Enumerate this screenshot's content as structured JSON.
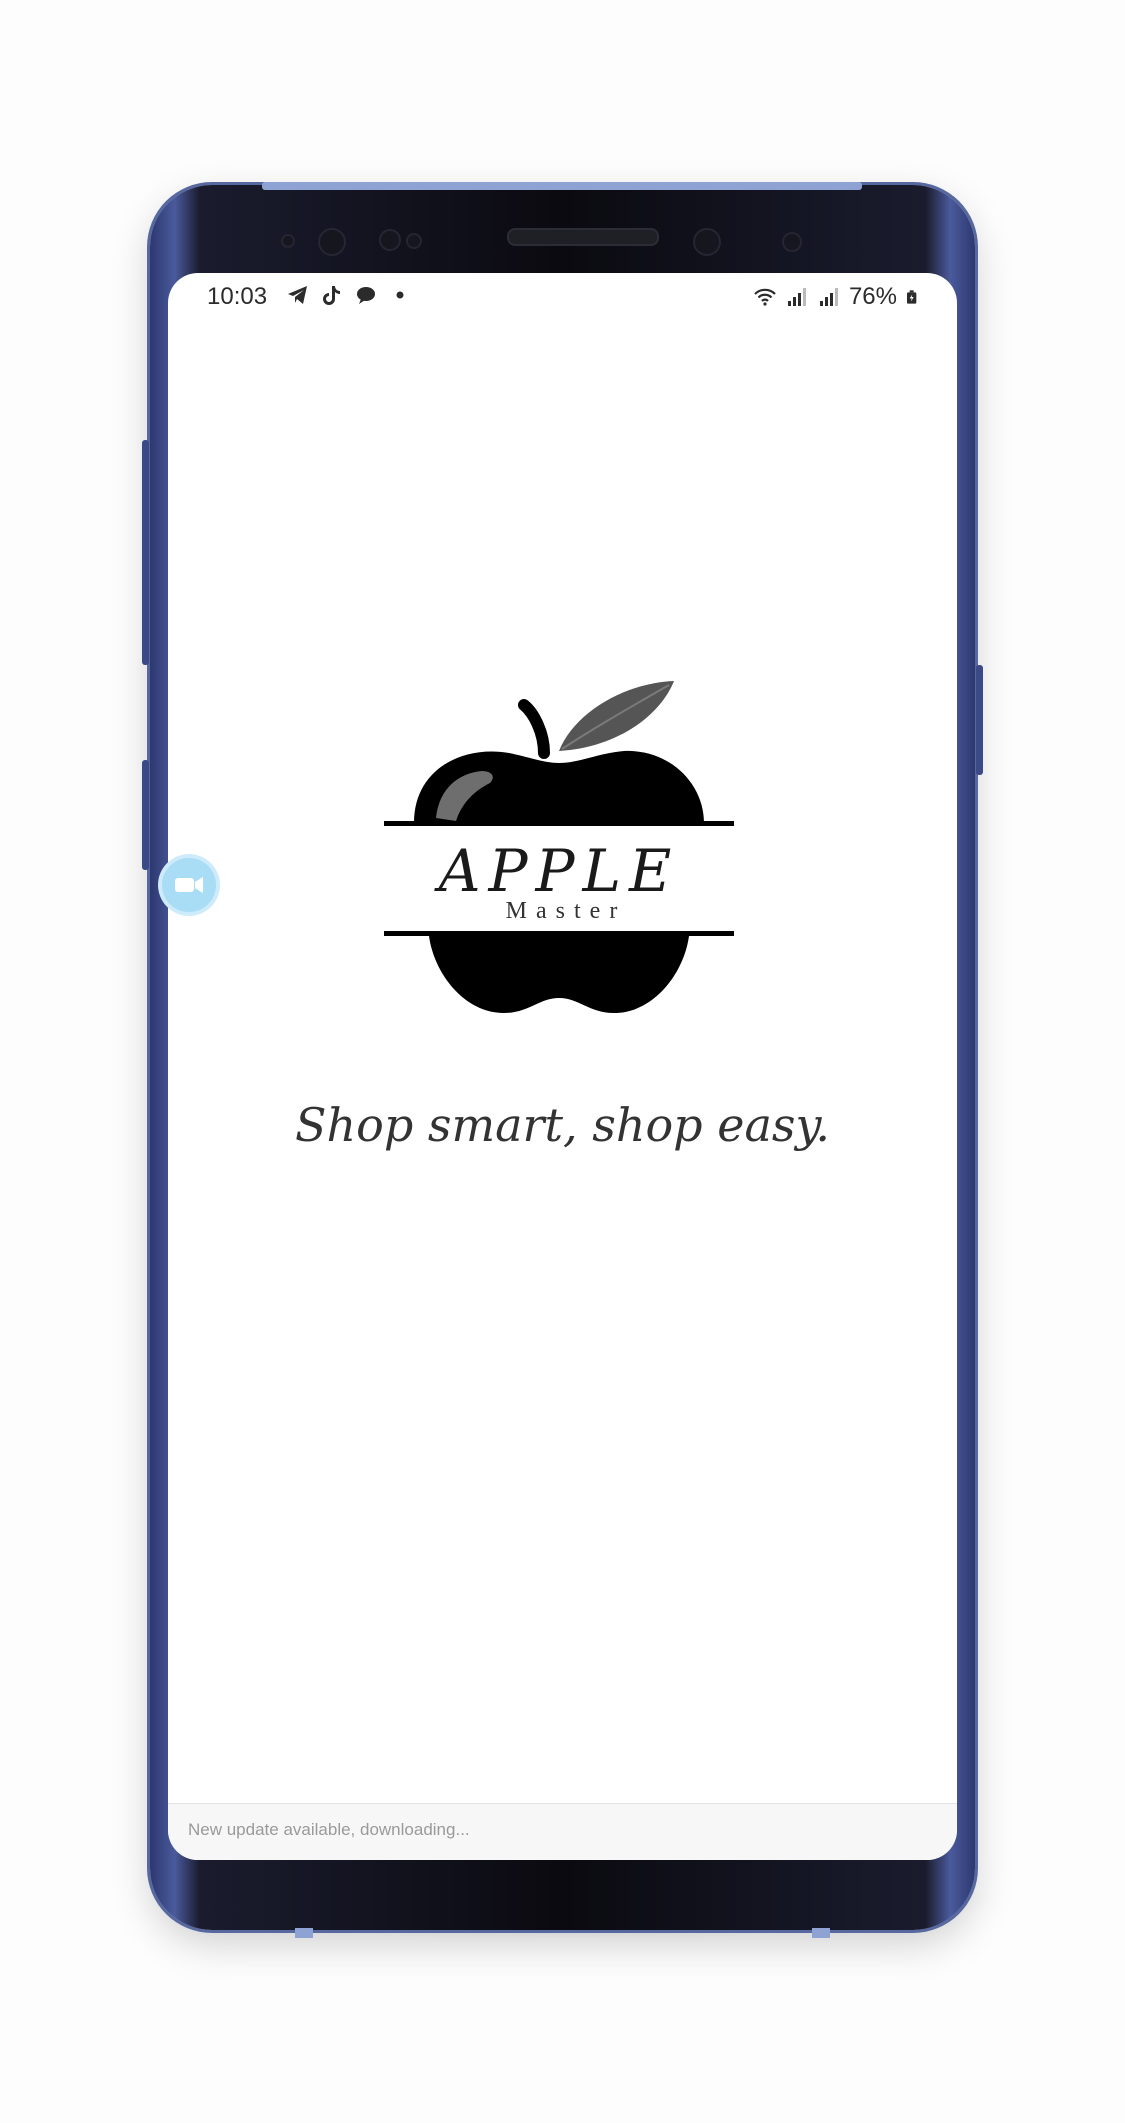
{
  "status_bar": {
    "time": "10:03",
    "battery": "76%",
    "icons_left": [
      "telegram-icon",
      "tiktok-icon",
      "chat-bubble-icon",
      "dot-icon"
    ],
    "icons_right": [
      "wifi-icon",
      "signal-icon",
      "signal-icon",
      "battery-icon"
    ]
  },
  "logo": {
    "word": "APPLE",
    "subword": "Master",
    "leaf_color": "#555555",
    "fruit_color": "#000000"
  },
  "tagline": "Shop smart, shop easy.",
  "update_banner": {
    "text": "New update available, downloading..."
  },
  "floating_button": {
    "icon": "video-record-icon",
    "color": "#a9dcf5"
  }
}
